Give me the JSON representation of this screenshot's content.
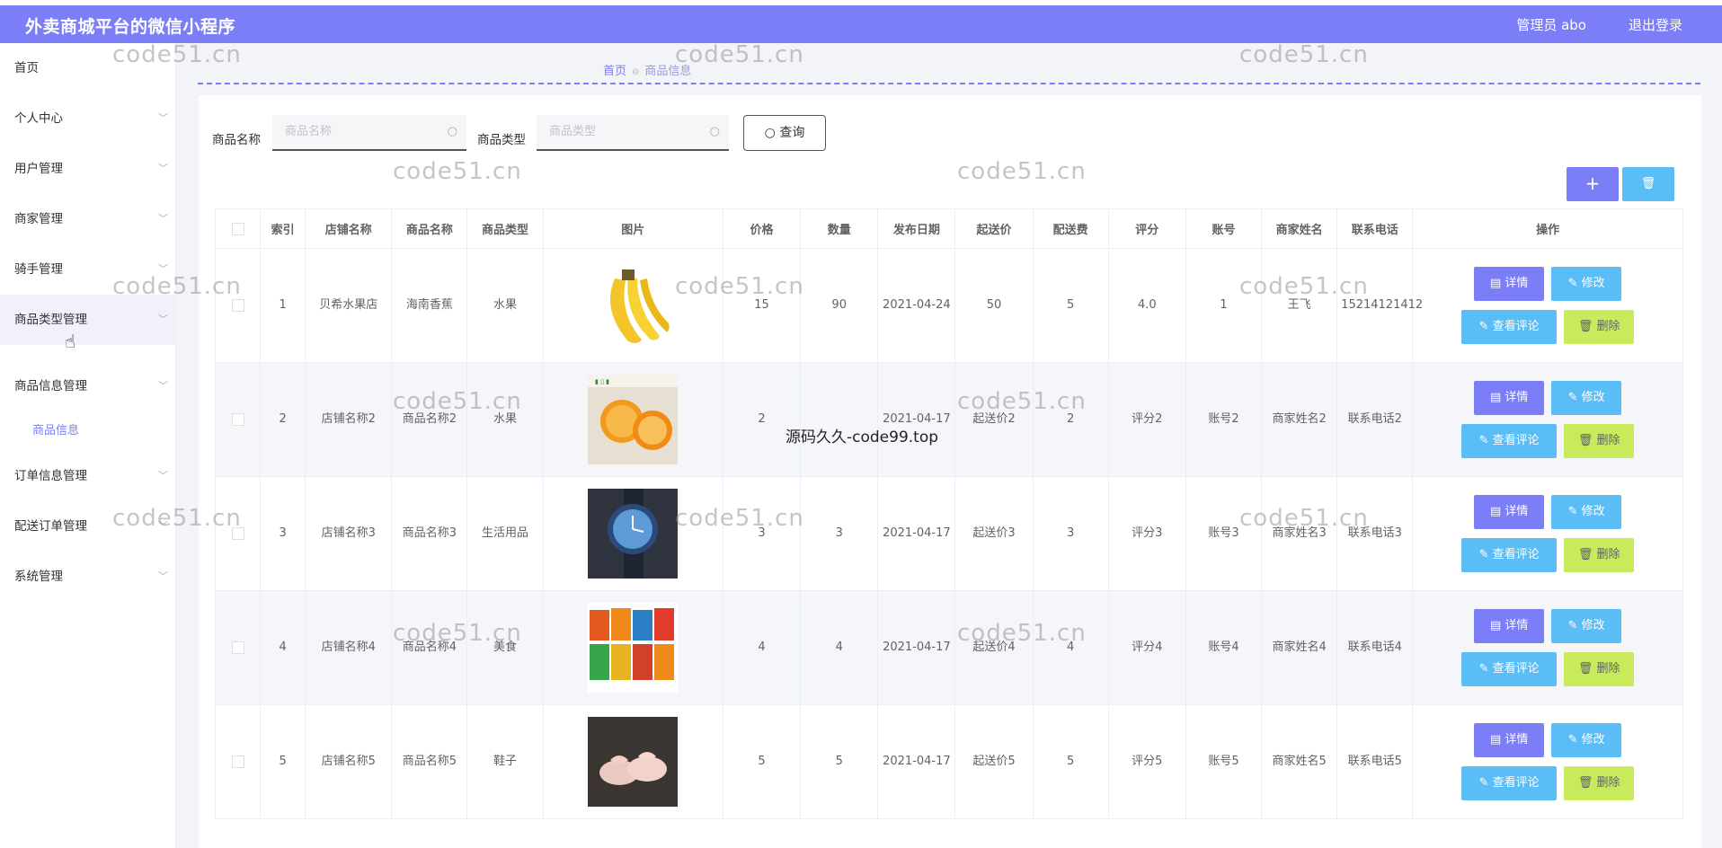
{
  "header": {
    "title": "外卖商城平台的微信小程序",
    "admin": "管理员 abo",
    "logout": "退出登录"
  },
  "sidebar": {
    "items": [
      {
        "label": "首页",
        "chevron": false
      },
      {
        "label": "个人中心",
        "chevron": true
      },
      {
        "label": "用户管理",
        "chevron": true
      },
      {
        "label": "商家管理",
        "chevron": true
      },
      {
        "label": "骑手管理",
        "chevron": true
      },
      {
        "label": "商品类型管理",
        "chevron": true
      },
      {
        "label": "商品信息管理",
        "chevron": true
      },
      {
        "label": "商品信息",
        "sub": true
      },
      {
        "label": "订单信息管理",
        "chevron": true
      },
      {
        "label": "配送订单管理",
        "chevron": true
      },
      {
        "label": "系统管理",
        "chevron": true
      }
    ]
  },
  "breadcrumb": {
    "home": "首页",
    "current": "商品信息"
  },
  "search": {
    "name_label": "商品名称",
    "name_placeholder": "商品名称",
    "type_label": "商品类型",
    "type_placeholder": "商品类型",
    "query_button": "查询"
  },
  "toolbar": {
    "add": "+",
    "delete": "🗑"
  },
  "table": {
    "columns": [
      "索引",
      "店铺名称",
      "商品名称",
      "商品类型",
      "图片",
      "价格",
      "数量",
      "发布日期",
      "起送价",
      "配送费",
      "评分",
      "账号",
      "商家姓名",
      "联系电话",
      "操作"
    ],
    "rows": [
      {
        "index": "1",
        "shop": "贝希水果店",
        "name": "海南香蕉",
        "type": "水果",
        "image": "banana",
        "price": "15",
        "qty": "90",
        "date": "2021-04-24",
        "min_price": "50",
        "fee": "5",
        "score": "4.0",
        "account": "1",
        "merchant": "王飞",
        "phone": "15214121412"
      },
      {
        "index": "2",
        "shop": "店铺名称2",
        "name": "商品名称2",
        "type": "水果",
        "image": "orange",
        "price": "2",
        "qty": "",
        "date": "2021-04-17",
        "min_price": "起送价2",
        "fee": "2",
        "score": "评分2",
        "account": "账号2",
        "merchant": "商家姓名2",
        "phone": "联系电话2"
      },
      {
        "index": "3",
        "shop": "店铺名称3",
        "name": "商品名称3",
        "type": "生活用品",
        "image": "watch",
        "price": "3",
        "qty": "3",
        "date": "2021-04-17",
        "min_price": "起送价3",
        "fee": "3",
        "score": "评分3",
        "account": "账号3",
        "merchant": "商家姓名3",
        "phone": "联系电话3"
      },
      {
        "index": "4",
        "shop": "店铺名称4",
        "name": "商品名称4",
        "type": "美食",
        "image": "snack",
        "price": "4",
        "qty": "4",
        "date": "2021-04-17",
        "min_price": "起送价4",
        "fee": "4",
        "score": "评分4",
        "account": "账号4",
        "merchant": "商家姓名4",
        "phone": "联系电话4"
      },
      {
        "index": "5",
        "shop": "店铺名称5",
        "name": "商品名称5",
        "type": "鞋子",
        "image": "shoes",
        "price": "5",
        "qty": "5",
        "date": "2021-04-17",
        "min_price": "起送价5",
        "fee": "5",
        "score": "评分5",
        "account": "账号5",
        "merchant": "商家姓名5",
        "phone": "联系电话5"
      }
    ],
    "actions": {
      "detail": "详情",
      "edit": "修改",
      "review": "查看评论",
      "delete": "删除"
    }
  },
  "watermarks": {
    "main": "code51.cn",
    "secondary": "源码久久-code99.top"
  },
  "colors": {
    "primary": "#7b7ef6",
    "info": "#5bbdf5",
    "delete": "#c8ea5b"
  }
}
